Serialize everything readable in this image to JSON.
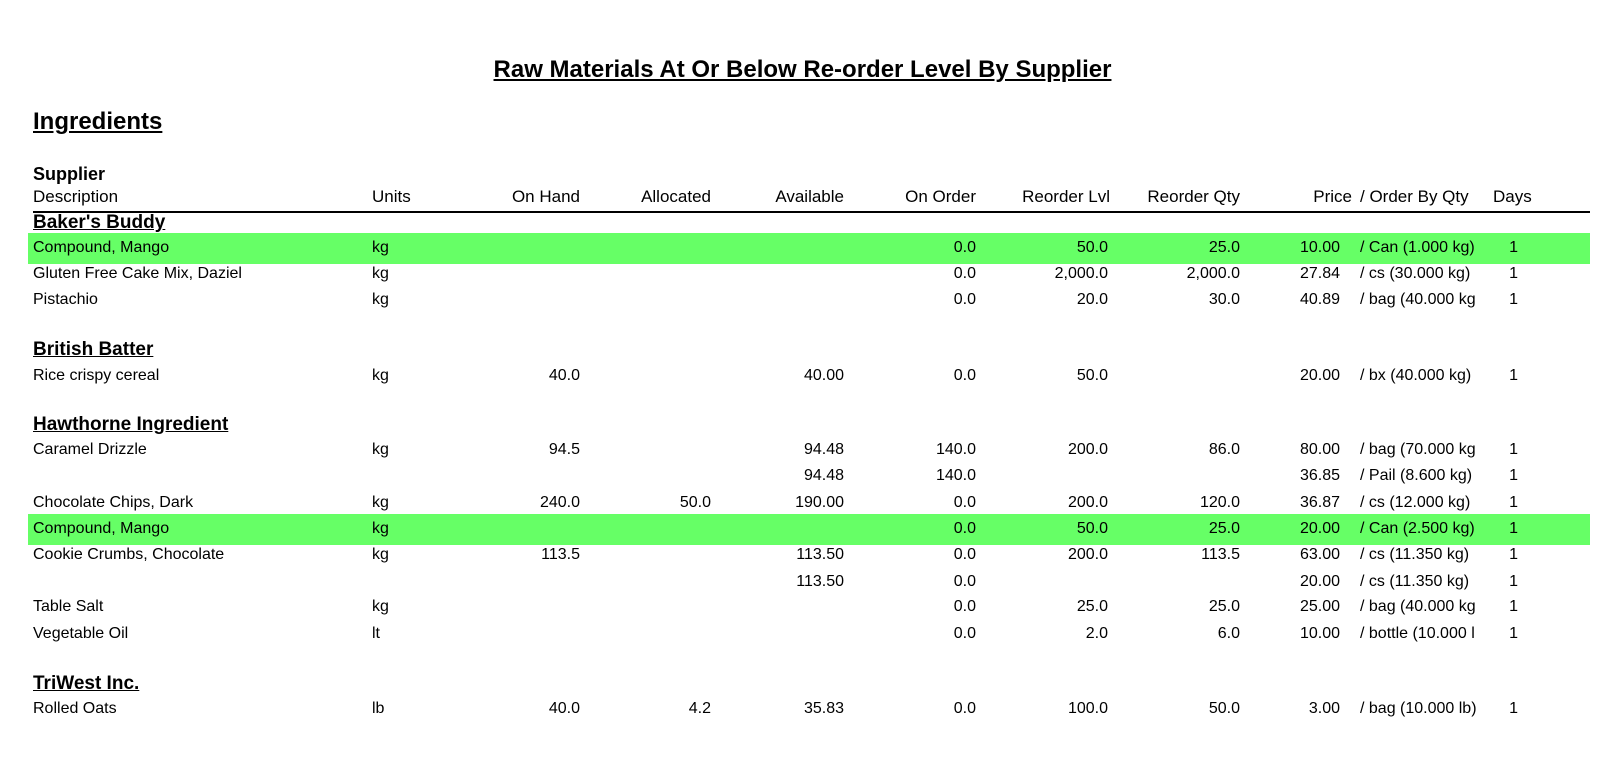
{
  "report": {
    "title": "Raw Materials At Or Below Re-order Level By Supplier",
    "section": "Ingredients",
    "supplier_header": "Supplier"
  },
  "columns": {
    "description": "Description",
    "units": "Units",
    "on_hand": "On Hand",
    "allocated": "Allocated",
    "available": "Available",
    "on_order": "On Order",
    "reorder_lvl": "Reorder Lvl",
    "reorder_qty": "Reorder Qty",
    "price": "Price",
    "order_by_qty": "/ Order By Qty",
    "days": "Days"
  },
  "highlight_color": "#66ff66",
  "suppliers": [
    {
      "name": "Baker's Buddy",
      "rows": [
        {
          "description": "Compound, Mango",
          "units": "kg",
          "on_hand": "",
          "allocated": "",
          "available": "",
          "on_order": "0.0",
          "reorder_lvl": "50.0",
          "reorder_qty": "25.0",
          "price": "10.00",
          "order_by": "/ Can (1.000 kg)",
          "days": "1",
          "highlight": true
        },
        {
          "description": "Gluten Free Cake Mix, Daziel",
          "units": "kg",
          "on_hand": "",
          "allocated": "",
          "available": "",
          "on_order": "0.0",
          "reorder_lvl": "2,000.0",
          "reorder_qty": "2,000.0",
          "price": "27.84",
          "order_by": "/ cs (30.000 kg)",
          "days": "1",
          "highlight": false
        },
        {
          "description": "Pistachio",
          "units": "kg",
          "on_hand": "",
          "allocated": "",
          "available": "",
          "on_order": "0.0",
          "reorder_lvl": "20.0",
          "reorder_qty": "30.0",
          "price": "40.89",
          "order_by": "/ bag (40.000 kg",
          "days": "1",
          "highlight": false
        }
      ]
    },
    {
      "name": "British Batter",
      "rows": [
        {
          "description": "Rice crispy cereal",
          "units": "kg",
          "on_hand": "40.0",
          "allocated": "",
          "available": "40.00",
          "on_order": "0.0",
          "reorder_lvl": "50.0",
          "reorder_qty": "",
          "price": "20.00",
          "order_by": "/ bx (40.000 kg)",
          "days": "1",
          "highlight": false
        }
      ]
    },
    {
      "name": "Hawthorne Ingredient",
      "rows": [
        {
          "description": "Caramel Drizzle",
          "units": "kg",
          "on_hand": "94.5",
          "allocated": "",
          "available": "94.48",
          "on_order": "140.0",
          "reorder_lvl": "200.0",
          "reorder_qty": "86.0",
          "price": "80.00",
          "order_by": "/ bag (70.000 kg",
          "days": "1",
          "highlight": false
        },
        {
          "description": "",
          "units": "",
          "on_hand": "",
          "allocated": "",
          "available": "94.48",
          "on_order": "140.0",
          "reorder_lvl": "",
          "reorder_qty": "",
          "price": "36.85",
          "order_by": "/ Pail (8.600 kg)",
          "days": "1",
          "highlight": false
        },
        {
          "description": "Chocolate Chips, Dark",
          "units": "kg",
          "on_hand": "240.0",
          "allocated": "50.0",
          "available": "190.00",
          "on_order": "0.0",
          "reorder_lvl": "200.0",
          "reorder_qty": "120.0",
          "price": "36.87",
          "order_by": "/ cs (12.000 kg)",
          "days": "1",
          "highlight": false
        },
        {
          "description": "Compound, Mango",
          "units": "kg",
          "on_hand": "",
          "allocated": "",
          "available": "",
          "on_order": "0.0",
          "reorder_lvl": "50.0",
          "reorder_qty": "25.0",
          "price": "20.00",
          "order_by": "/ Can (2.500 kg)",
          "days": "1",
          "highlight": true
        },
        {
          "description": "Cookie Crumbs, Chocolate",
          "units": "kg",
          "on_hand": "113.5",
          "allocated": "",
          "available": "113.50",
          "on_order": "0.0",
          "reorder_lvl": "200.0",
          "reorder_qty": "113.5",
          "price": "63.00",
          "order_by": "/ cs (11.350 kg)",
          "days": "1",
          "highlight": false
        },
        {
          "description": "",
          "units": "",
          "on_hand": "",
          "allocated": "",
          "available": "113.50",
          "on_order": "0.0",
          "reorder_lvl": "",
          "reorder_qty": "",
          "price": "20.00",
          "order_by": "/ cs (11.350 kg)",
          "days": "1",
          "highlight": false
        },
        {
          "description": "Table Salt",
          "units": "kg",
          "on_hand": "",
          "allocated": "",
          "available": "",
          "on_order": "0.0",
          "reorder_lvl": "25.0",
          "reorder_qty": "25.0",
          "price": "25.00",
          "order_by": "/ bag (40.000 kg",
          "days": "1",
          "highlight": false
        },
        {
          "description": "Vegetable Oil",
          "units": "lt",
          "on_hand": "",
          "allocated": "",
          "available": "",
          "on_order": "0.0",
          "reorder_lvl": "2.0",
          "reorder_qty": "6.0",
          "price": "10.00",
          "order_by": "/ bottle (10.000 l",
          "days": "1",
          "highlight": false
        }
      ]
    },
    {
      "name": "TriWest Inc.",
      "rows": [
        {
          "description": "Rolled Oats",
          "units": "lb",
          "on_hand": "40.0",
          "allocated": "4.2",
          "available": "35.83",
          "on_order": "0.0",
          "reorder_lvl": "100.0",
          "reorder_qty": "50.0",
          "price": "3.00",
          "order_by": "/ bag (10.000 lb)",
          "days": "1",
          "highlight": false
        }
      ]
    }
  ]
}
